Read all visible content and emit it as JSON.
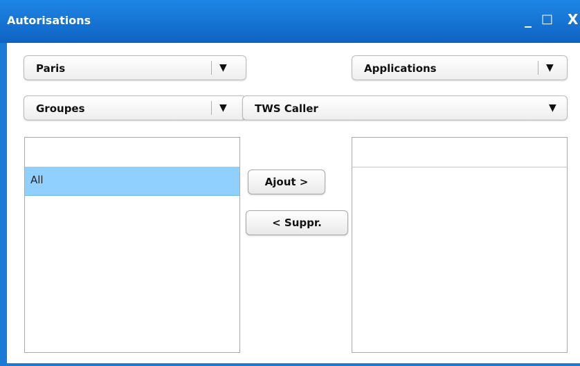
{
  "window": {
    "title": "Autorisations",
    "minimize_glyph": "_",
    "maximize_glyph": "□",
    "close_glyph": "X"
  },
  "filters": {
    "location": {
      "selected": "Paris",
      "arrow": "▼"
    },
    "type": {
      "selected": "Applications",
      "arrow": "▼"
    },
    "group": {
      "selected": "Groupes",
      "arrow": "▼"
    },
    "application": {
      "selected": "TWS Caller",
      "arrow": "▼"
    }
  },
  "left_list": {
    "items": [
      {
        "label": "All",
        "selected": true
      }
    ]
  },
  "right_list": {
    "items": []
  },
  "buttons": {
    "add_label": "Ajout >",
    "remove_label": "< Suppr."
  },
  "colors": {
    "titlebar": "#1a7ad4",
    "selection": "#8fd0ff"
  }
}
